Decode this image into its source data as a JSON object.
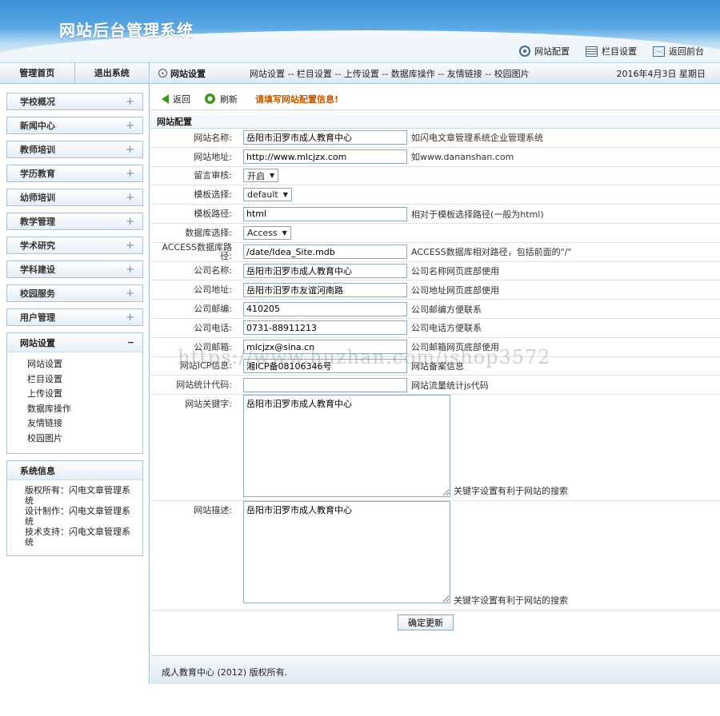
{
  "header": {
    "title": "网站后台管理系统",
    "nav": [
      {
        "icon": "gear-icon",
        "label": "网站配置"
      },
      {
        "icon": "list-icon",
        "label": "栏目设置"
      },
      {
        "icon": "mail-icon",
        "label": "返回前台"
      }
    ]
  },
  "lefttop": {
    "home": "管理首页",
    "logout": "退出系统"
  },
  "menu": [
    "学校概况",
    "新闻中心",
    "教师培训",
    "学历教育",
    "幼师培训",
    "教学管理",
    "学术研究",
    "学科建设",
    "校园服务",
    "用户管理"
  ],
  "menu_plus": "+",
  "open_menu": {
    "title": "网站设置",
    "minus": "−",
    "items": [
      "网站设置",
      "栏目设置",
      "上传设置",
      "数据库操作",
      "友情链接",
      "校园图片"
    ]
  },
  "sysinfo": {
    "title": "系统信息",
    "lines": [
      "版权所有：闪电文章管理系统",
      "设计制作：闪电文章管理系统",
      "技术支持：闪电文章管理系统"
    ]
  },
  "crumb": {
    "current": "网站设置",
    "links": "网站设置 -- 栏目设置 -- 上传设置 -- 数据库操作 -- 友情链接 -- 校园图片",
    "date": "2016年4月3日 星期日"
  },
  "toolbar": {
    "back": "返回",
    "refresh": "刷新",
    "msg": "请填写网站配置信息!"
  },
  "form": {
    "title": "网站配置",
    "rows": [
      {
        "label": "网站名称:",
        "type": "input",
        "value": "岳阳市汨罗市成人教育中心",
        "hint": "如闪电文章管理系统企业管理系统"
      },
      {
        "label": "网站地址:",
        "type": "input",
        "value": "http://www.mlcjzx.com",
        "hint": "如www.dananshan.com"
      },
      {
        "label": "留言审核:",
        "type": "select",
        "value": "开启",
        "hint": ""
      },
      {
        "label": "模板选择:",
        "type": "select",
        "value": "default",
        "hint": ""
      },
      {
        "label": "模板路径:",
        "type": "input",
        "value": "html",
        "hint": "相对于模板选择路径(一般为html)"
      },
      {
        "label": "数据库选择:",
        "type": "select",
        "value": "Access",
        "hint": ""
      },
      {
        "label": "ACCESS数据库路径:",
        "type": "input",
        "value": "/date/Idea_Site.mdb",
        "hint": "ACCESS数据库相对路径，包括前面的\"/\""
      },
      {
        "label": "公司名称:",
        "type": "input",
        "value": "岳阳市汨罗市成人教育中心",
        "hint": "公司名称网页底部使用"
      },
      {
        "label": "公司地址:",
        "type": "input",
        "value": "岳阳市汨罗市友谊河南路",
        "hint": "公司地址网页底部使用"
      },
      {
        "label": "公司邮编:",
        "type": "input",
        "value": "410205",
        "hint": "公司邮编方便联系"
      },
      {
        "label": "公司电话:",
        "type": "input",
        "value": "0731-88911213",
        "hint": "公司电话方便联系"
      },
      {
        "label": "公司邮箱:",
        "type": "input",
        "value": "mlcjzx@sina.cn",
        "hint": "公司邮箱网页底部使用"
      },
      {
        "label": "网站ICP信息:",
        "type": "input",
        "value": "湘ICP备08106346号",
        "hint": "网站备案信息"
      },
      {
        "label": "网站统计代码:",
        "type": "input",
        "value": "",
        "hint": "网站流量统计js代码"
      }
    ],
    "keywords": {
      "label": "网站关键字:",
      "value": "岳阳市汨罗市成人教育中心",
      "hint": "关键字设置有利于网站的搜索"
    },
    "description": {
      "label": "网站描述:",
      "value": "岳阳市汨罗市成人教育中心",
      "hint": "关键字设置有利于网站的搜索"
    },
    "submit": "确定更新"
  },
  "footer": "成人教育中心 (2012) 版权所有.",
  "watermark": "https://www.huzhan.com/ishop3572"
}
